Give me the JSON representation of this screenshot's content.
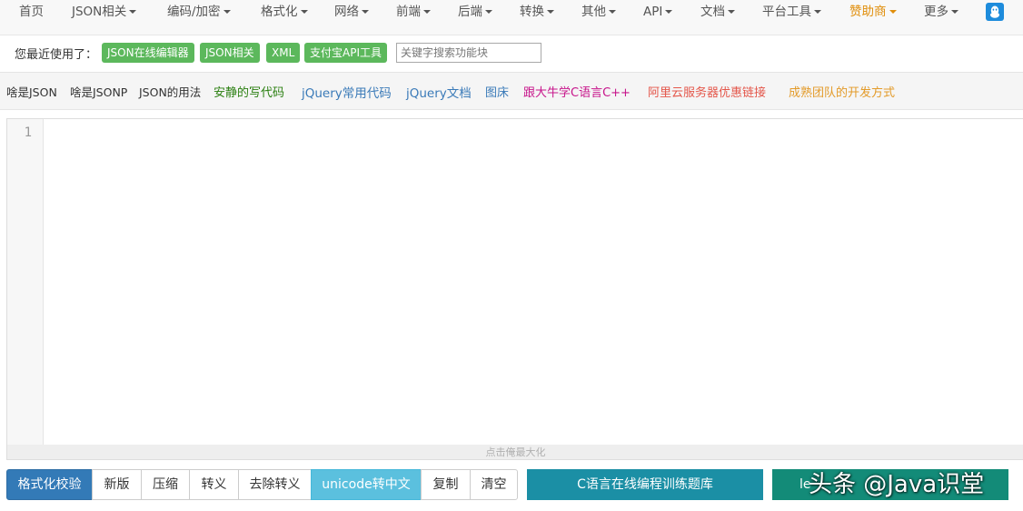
{
  "nav": {
    "items": [
      {
        "label": "首页",
        "dropdown": false
      },
      {
        "label": "JSON相关",
        "dropdown": true
      },
      {
        "label": "编码/加密",
        "dropdown": true
      },
      {
        "label": "格式化",
        "dropdown": true
      },
      {
        "label": "网络",
        "dropdown": true
      },
      {
        "label": "前端",
        "dropdown": true
      },
      {
        "label": "后端",
        "dropdown": true
      },
      {
        "label": "转换",
        "dropdown": true
      },
      {
        "label": "其他",
        "dropdown": true
      },
      {
        "label": "API",
        "dropdown": true
      },
      {
        "label": "文档",
        "dropdown": true
      },
      {
        "label": "平台工具",
        "dropdown": true
      },
      {
        "label": "赞助商",
        "dropdown": true,
        "accent": "#e08e0b"
      },
      {
        "label": "更多",
        "dropdown": true
      }
    ],
    "qq_icon": "qq-icon"
  },
  "recent": {
    "label": "您最近使用了：",
    "tags": [
      "JSON在线编辑器",
      "JSON相关",
      "XML",
      "支付宝API工具"
    ],
    "search_placeholder": "关键字搜索功能块"
  },
  "links": [
    {
      "text": "啥是JSON",
      "color": "#333333"
    },
    {
      "text": "啥是JSONP",
      "color": "#333333"
    },
    {
      "text": "JSON的用法",
      "color": "#333333"
    },
    {
      "text": "安静的写代码",
      "color": "#2a7f10"
    },
    {
      "text": "jQuery常用代码",
      "color": "#3a7ab8"
    },
    {
      "text": "jQuery文档",
      "color": "#3a7ab8"
    },
    {
      "text": "图床",
      "color": "#3a7ab8"
    },
    {
      "text": "跟大牛学C语言C++",
      "color": "#c7158b"
    },
    {
      "text": "阿里云服务器优惠链接",
      "color": "#e4574b"
    },
    {
      "text": "成熟团队的开发方式",
      "color": "#e39b2a"
    }
  ],
  "editor": {
    "line_number": "1",
    "maximize_label": "点击俺最大化"
  },
  "buttons": {
    "format_validate": "格式化校验",
    "new_version": "新版",
    "compress": "压缩",
    "escape": "转义",
    "unescape": "去除转义",
    "unicode_to_cn": "unicode转中文",
    "copy": "复制",
    "clear": "清空",
    "c_training": "C语言在线编程训练题库",
    "leetcode_partial": "le"
  },
  "watermark": "头条 @Java识堂",
  "colors": {
    "primary": "#337ab7",
    "info": "#5bc0de",
    "success": "#5cb85c",
    "teal": "#1b8fa5",
    "green_teal": "#138b78"
  }
}
